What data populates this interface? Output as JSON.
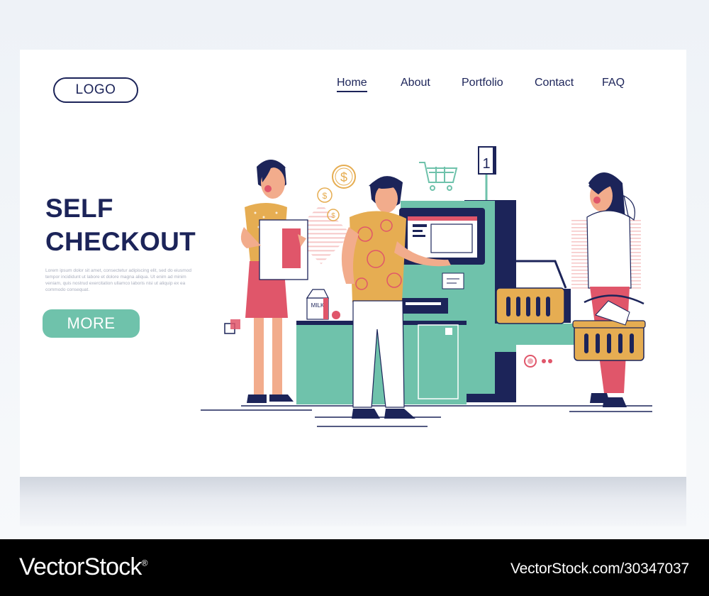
{
  "header": {
    "logo_label": "LOGO",
    "nav": [
      {
        "label": "Home",
        "active": true
      },
      {
        "label": "About",
        "active": false
      },
      {
        "label": "Portfolio",
        "active": false
      },
      {
        "label": "Contact",
        "active": false
      },
      {
        "label": "FAQ",
        "active": false
      }
    ]
  },
  "hero": {
    "title_line1": "SELF",
    "title_line2": "CHECKOUT",
    "description": "Lorem ipsum dolor sit amet, consectetur adipiscing elit, sed do eiusmod tempor incididunt ut labore et dolore magna aliqua. Ut enim ad minim veniam, quis nostrud exercitation ullamco laboris nisi ut aliquip ex ea commodo consequat.",
    "button_label": "MORE"
  },
  "illustration": {
    "kiosk_number": "1",
    "milk_label": "MILK",
    "icons": [
      "dollar-coin-icon",
      "shopping-cart-icon",
      "shopping-basket-icon"
    ],
    "colors": {
      "navy": "#1c2459",
      "teal": "#6fc2ab",
      "mustard": "#e6ad52",
      "pink": "#e0566a",
      "skin": "#f2ac8c"
    }
  },
  "footer": {
    "brand": "VectorStock",
    "registered_mark": "®",
    "image_id": "VectorStock.com/30347037"
  }
}
